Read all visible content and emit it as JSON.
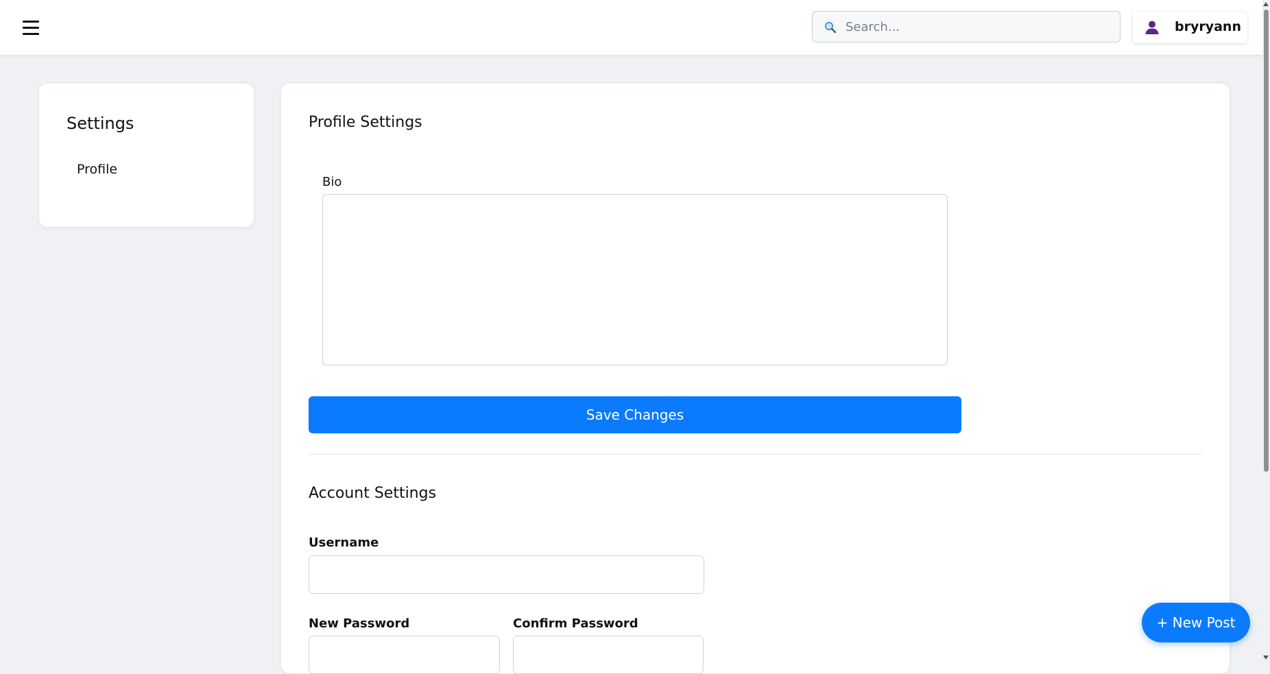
{
  "header": {
    "menu_icon": "hamburger-icon",
    "search": {
      "placeholder": "Search...",
      "value": "",
      "icon": "search-icon"
    },
    "user": {
      "name": "bryryann",
      "icon": "user-icon"
    }
  },
  "sidebar": {
    "title": "Settings",
    "items": [
      {
        "label": "Profile"
      }
    ]
  },
  "main": {
    "profile_settings": {
      "title": "Profile Settings",
      "bio_label": "Bio",
      "bio_value": "",
      "save_label": "Save Changes"
    },
    "account_settings": {
      "title": "Account Settings",
      "username_label": "Username",
      "username_value": "",
      "new_password_label": "New Password",
      "confirm_password_label": "Confirm Password"
    }
  },
  "fab": {
    "label": "+ New Post"
  },
  "colors": {
    "accent": "#0a7bff",
    "page_bg": "#f0f1f4",
    "card_bg": "#ffffff",
    "avatar": "#5b2a86",
    "search_icon": "#4a90e2"
  }
}
